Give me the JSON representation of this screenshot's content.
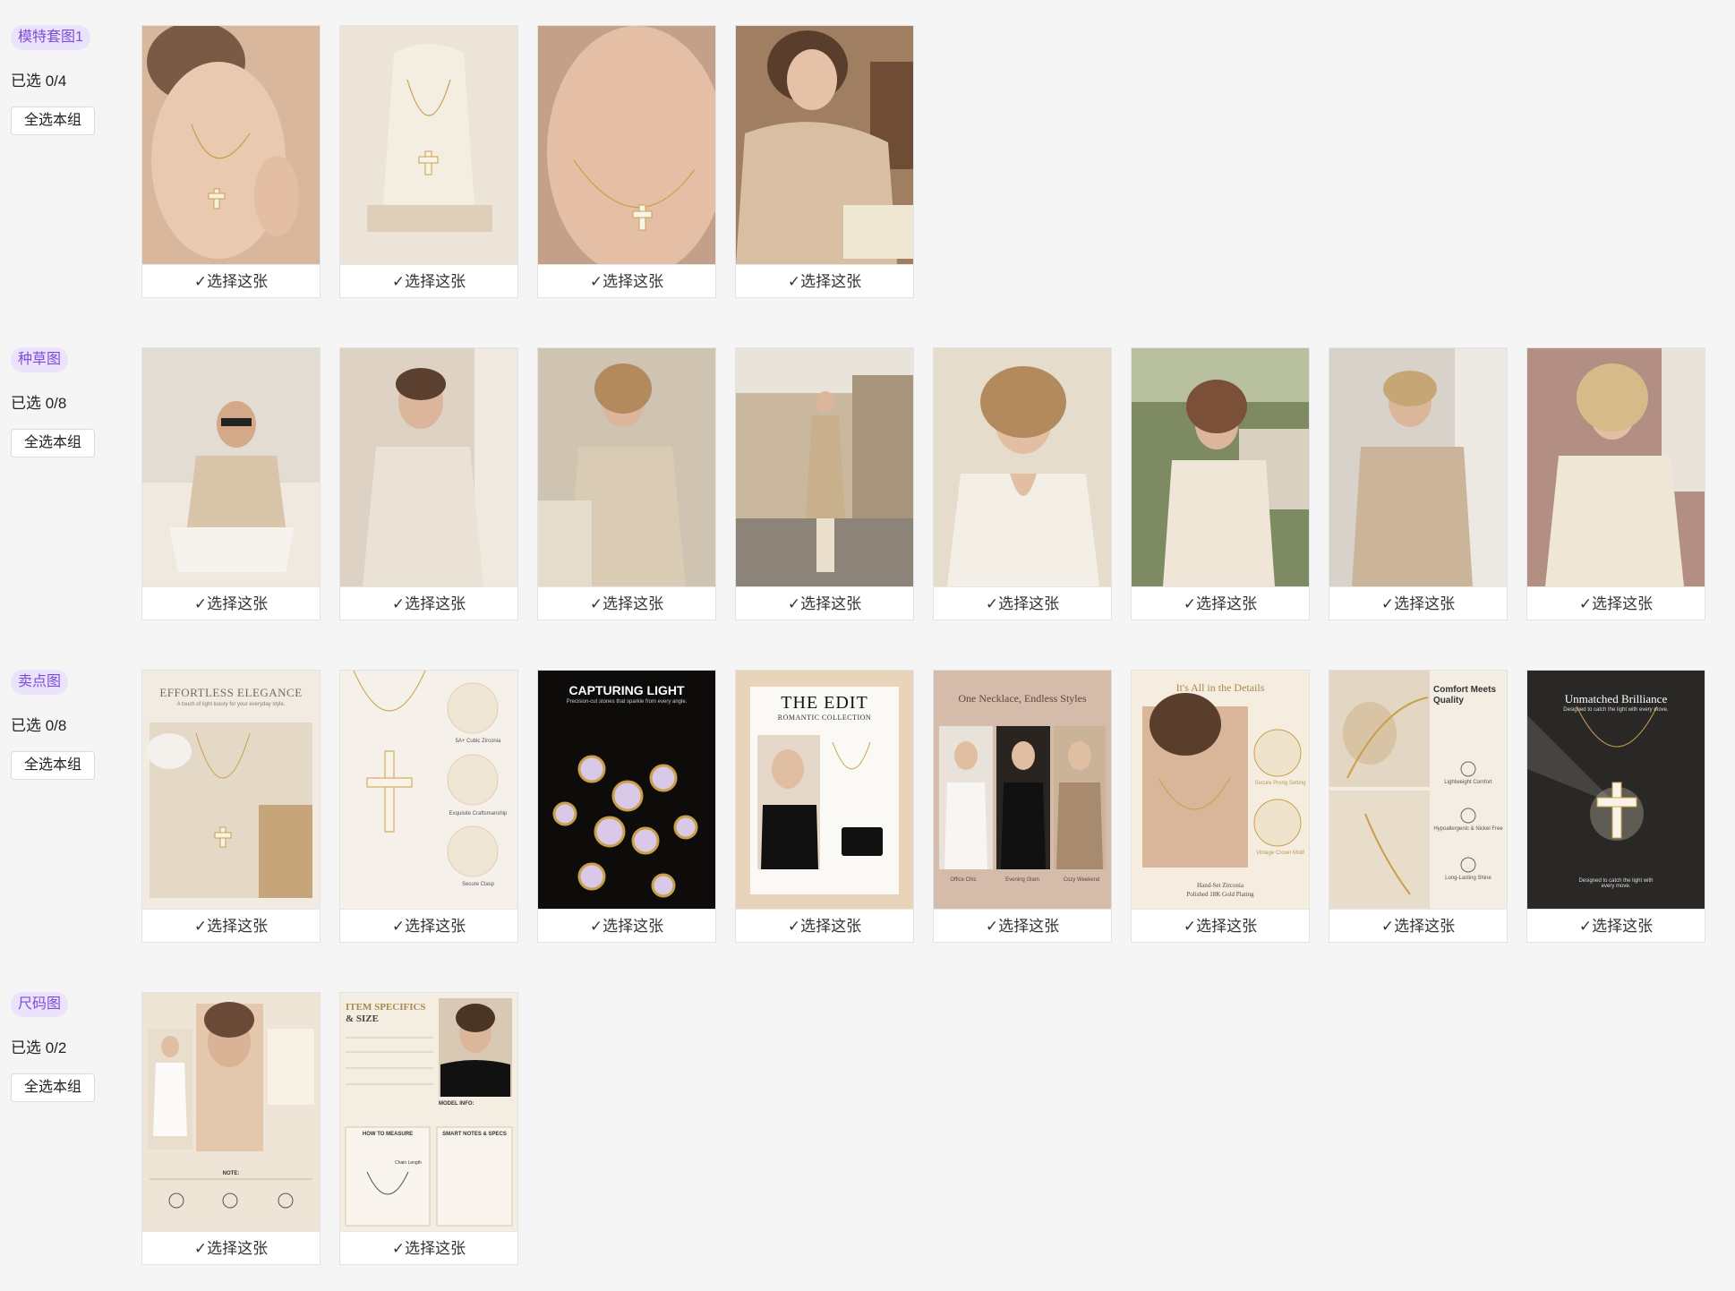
{
  "select_label": "✓选择这张",
  "select_all_label": "全选本组",
  "groups": [
    {
      "tag": "模特套图1",
      "count": "已选 0/4"
    },
    {
      "tag": "种草图",
      "count": "已选 0/8"
    },
    {
      "tag": "卖点图",
      "count": "已选 0/8"
    },
    {
      "tag": "尺码图",
      "count": "已选 0/2"
    }
  ],
  "selling_points": {
    "c1": {
      "title": "EFFORTLESS ELEGANCE",
      "sub": "A touch of light luxury for your everyday style."
    },
    "c2": {
      "l1": "5A+ Cubic Zirconia",
      "l2": "Exquisite Craftsmanship",
      "l3": "Secure Clasp"
    },
    "c3": {
      "title": "CAPTURING LIGHT",
      "sub": "Precision-cut stones that sparkle from every angle."
    },
    "c4": {
      "title": "THE EDIT",
      "sub": "ROMANTIC COLLECTION"
    },
    "c5": {
      "title": "One Necklace, Endless Styles",
      "l1": "Office Chic",
      "l2": "Evening Glam",
      "l3": "Cozy Weekend"
    },
    "c6": {
      "title": "It's All in the Details",
      "l1": "Secure Prong Setting",
      "l2": "Vintage Crown Motif",
      "foot1": "Hand-Set Zirconia",
      "foot2": "Polished 18K Gold Plating"
    },
    "c7": {
      "title": "Comfort Meets Quality",
      "l1": "Lightweight Comfort",
      "l2": "Hypoallergenic & Nickel Free",
      "l3": "Long-Lasting Shine"
    },
    "c8": {
      "title": "Unmatched Brilliance",
      "sub": "Designed to catch the light with every move.",
      "foot": "Designed to catch the light with every move."
    }
  },
  "size_charts": {
    "c1": {
      "note": "NOTE:"
    },
    "c2": {
      "title1": "ITEM SPECIFICS",
      "title2": "& SIZE",
      "model": "MODEL INFO:",
      "measure": "HOW TO MEASURE",
      "notes": "SMART NOTES & SPECS",
      "chain": "Chain Length"
    }
  }
}
